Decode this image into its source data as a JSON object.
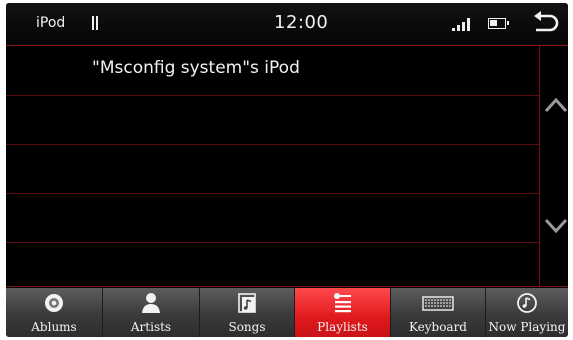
{
  "status_bar": {
    "source": "iPod",
    "clock": "12:00"
  },
  "list": {
    "rows": [
      "\"Msconfig system\"s iPod",
      "",
      "",
      "",
      ""
    ]
  },
  "tabs": [
    {
      "label": "Ablums",
      "icon": "album-icon",
      "active": false
    },
    {
      "label": "Artists",
      "icon": "artist-icon",
      "active": false
    },
    {
      "label": "Songs",
      "icon": "song-icon",
      "active": false
    },
    {
      "label": "Playlists",
      "icon": "playlist-icon",
      "active": true
    },
    {
      "label": "Keyboard",
      "icon": "keyboard-icon",
      "active": false
    },
    {
      "label": "Now Playing",
      "icon": "now-playing-icon",
      "active": false
    }
  ],
  "colors": {
    "accent": "#e0191d",
    "background": "#000000",
    "divider": "#5a0d10"
  }
}
